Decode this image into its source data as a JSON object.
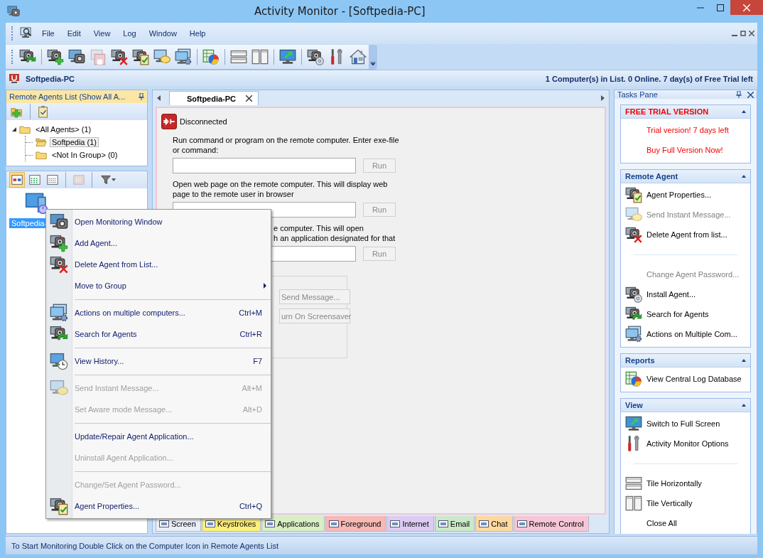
{
  "window": {
    "title": "Activity Monitor - [Softpedia-PC]"
  },
  "menu_bar": [
    "File",
    "Edit",
    "View",
    "Log",
    "Window",
    "Help"
  ],
  "agent_bar": {
    "name": "Softpedia-PC",
    "status": "1 Computer(s) in List. 0 Online. 7 day(s) of Free Trial left"
  },
  "agents_panel": {
    "title": "Remote Agents List (Show All A...",
    "tree": [
      {
        "label": "<All Agents> (1)",
        "expanded": true,
        "selected": false,
        "children": [
          {
            "label": "Softpedia (1)",
            "selected": true
          },
          {
            "label": "<Not In Group> (0)",
            "selected": false
          }
        ]
      }
    ],
    "view_modes": [
      {
        "selected": true
      },
      {
        "selected": false
      },
      {
        "selected": false
      }
    ],
    "agents": [
      {
        "label": "Softpedia-",
        "selected": true
      }
    ]
  },
  "document_tab": {
    "title": "Softpedia-PC"
  },
  "remote": {
    "status": "Disconnected",
    "sections": [
      {
        "lines": [
          "Run command or program on the remote computer. Enter exe-file",
          "or command:"
        ],
        "covered": false,
        "button": {
          "label": "Run",
          "disabled": true
        }
      },
      {
        "lines": [
          "Open web page on the remote computer. This will display web",
          "page to the remote user in browser"
        ],
        "covered": false,
        "button": {
          "label": "Run",
          "disabled": true
        }
      },
      {
        "lines": [
          "e computer. This will open",
          "h an application designated for that"
        ],
        "covered": true,
        "button": {
          "label": "Run",
          "disabled": true
        }
      }
    ],
    "actions": [
      {
        "label": "Send Message...",
        "disabled": true
      },
      {
        "label": "urn On Screensaver",
        "disabled": true
      }
    ]
  },
  "bottom_tabs": [
    {
      "label": "Screen",
      "color": "#e9eef7"
    },
    {
      "label": "Keystrokes",
      "color": "#fdf07a"
    },
    {
      "label": "Applications",
      "color": "#d9efc4"
    },
    {
      "label": "Foreground",
      "color": "#f8b8b4"
    },
    {
      "label": "Internet",
      "color": "#dccbf2"
    },
    {
      "label": "Email",
      "color": "#cbe9c9"
    },
    {
      "label": "Chat",
      "color": "#fdd9a2"
    },
    {
      "label": "Remote Control",
      "color": "#f6c6d6"
    }
  ],
  "tasks_pane": {
    "title": "Tasks Pane",
    "groups": [
      {
        "title": "FREE TRIAL VERSION",
        "kind": "trial",
        "sections": [
          [
            {
              "label": "Trial version! 7 days left"
            },
            {
              "label": "Buy Full Version Now!"
            }
          ]
        ]
      },
      {
        "title": "Remote Agent",
        "kind": "normal",
        "sections": [
          [
            {
              "label": "Agent Properties...",
              "disabled": false
            },
            {
              "label": "Send Instant Message...",
              "disabled": true
            },
            {
              "label": "Delete Agent from list...",
              "disabled": false
            }
          ],
          [
            {
              "label": "Change Agent Password...",
              "disabled": true
            },
            {
              "label": "Install Agent...",
              "disabled": false
            },
            {
              "label": "Search for Agents",
              "disabled": false
            },
            {
              "label": "Actions on Multiple Com...",
              "disabled": false
            }
          ]
        ]
      },
      {
        "title": "Reports",
        "kind": "normal",
        "sections": [
          [
            {
              "label": "View Central Log Database",
              "disabled": false
            }
          ]
        ]
      },
      {
        "title": "View",
        "kind": "normal",
        "sections": [
          [
            {
              "label": "Switch to Full Screen",
              "disabled": false
            },
            {
              "label": "Activity Monitor Options",
              "disabled": false
            }
          ],
          [
            {
              "label": "Tile Horizontally",
              "disabled": false
            },
            {
              "label": "Tile Vertically",
              "disabled": false
            },
            {
              "label": "Close All",
              "disabled": false
            }
          ]
        ]
      }
    ]
  },
  "context_menu": {
    "groups": [
      [
        {
          "label": "Open Monitoring Window",
          "disabled": false
        },
        {
          "label": "Add Agent...",
          "disabled": false
        },
        {
          "label": "Delete Agent from List...",
          "disabled": false
        },
        {
          "label": "Move to Group",
          "disabled": false,
          "submenu": true
        }
      ],
      [
        {
          "label": "Actions on multiple computers...",
          "shortcut": "Ctrl+M",
          "disabled": false
        },
        {
          "label": "Search for Agents",
          "shortcut": "Ctrl+R",
          "disabled": false
        }
      ],
      [
        {
          "label": "View History...",
          "shortcut": "F7",
          "disabled": false
        }
      ],
      [
        {
          "label": "Send Instant Message...",
          "shortcut": "Alt+M",
          "disabled": true
        },
        {
          "label": "Set Aware mode Message...",
          "shortcut": "Alt+D",
          "disabled": true
        }
      ],
      [
        {
          "label": "Update/Repair Agent Application...",
          "disabled": false
        },
        {
          "label": "Uninstall Agent Application...",
          "disabled": true
        }
      ],
      [
        {
          "label": "Change/Set Agent Password...",
          "disabled": true
        },
        {
          "label": "Agent Properties...",
          "shortcut": "Ctrl+Q",
          "disabled": false
        }
      ]
    ]
  },
  "status_bar": "To Start Monitoring Double Click on the Computer Icon in Remote Agents List"
}
